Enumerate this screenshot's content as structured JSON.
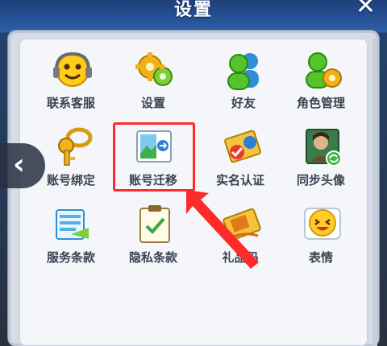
{
  "window": {
    "title": "设置",
    "close_symbol": "✕"
  },
  "nav": {
    "back_symbol": "‹"
  },
  "items": [
    {
      "label": "联系客服",
      "icon": "headset-smiley-icon"
    },
    {
      "label": "设置",
      "icon": "gears-icon"
    },
    {
      "label": "好友",
      "icon": "friends-icon"
    },
    {
      "label": "角色管理",
      "icon": "role-manage-icon"
    },
    {
      "label": "账号绑定",
      "icon": "key-bind-icon"
    },
    {
      "label": "账号迁移",
      "icon": "account-migrate-icon"
    },
    {
      "label": "实名认证",
      "icon": "real-name-icon"
    },
    {
      "label": "同步头像",
      "icon": "sync-avatar-icon"
    },
    {
      "label": "服务条款",
      "icon": "service-terms-icon"
    },
    {
      "label": "隐私条款",
      "icon": "privacy-terms-icon"
    },
    {
      "label": "礼品码",
      "icon": "gift-code-icon"
    },
    {
      "label": "表情",
      "icon": "emoji-icon"
    }
  ],
  "colors": {
    "highlight": "#ff2a2a",
    "label": "#3c4252"
  }
}
